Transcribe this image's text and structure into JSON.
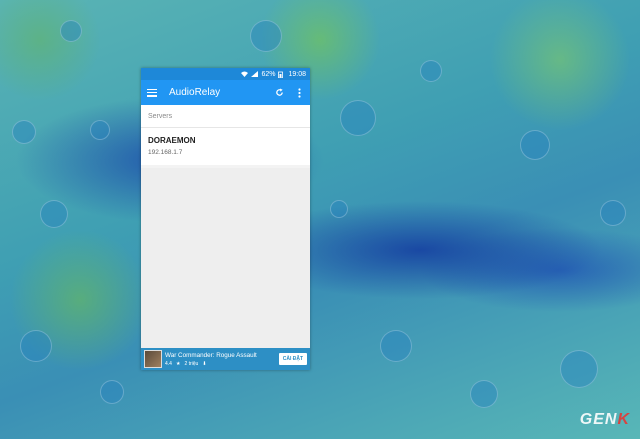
{
  "status_bar": {
    "battery": "62%",
    "time": "19:08"
  },
  "app_bar": {
    "title": "AudioRelay"
  },
  "servers_section": {
    "header": "Servers"
  },
  "servers": [
    {
      "name": "DORAEMON",
      "ip": "192.168.1.7"
    }
  ],
  "ad": {
    "title": "War Commander: Rogue Assault",
    "rating": "4.4",
    "installs": "2 triệu",
    "button_label": "CÀI ĐẶT"
  },
  "watermark": {
    "text_main": "GEN",
    "text_accent": "K"
  }
}
